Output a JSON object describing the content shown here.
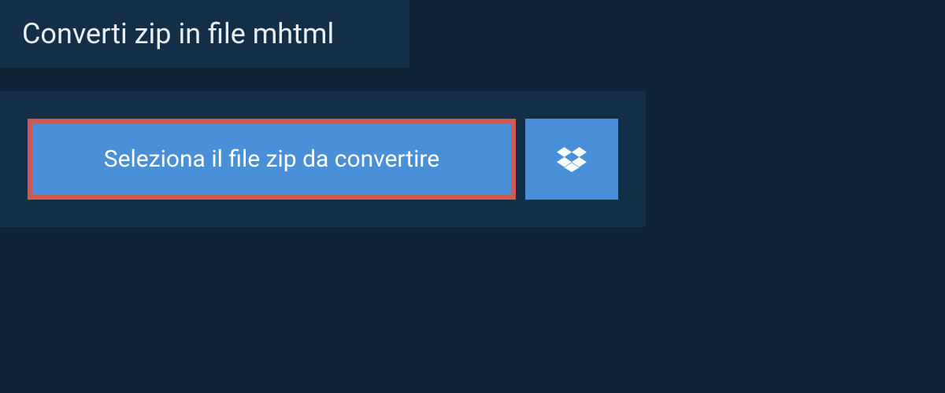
{
  "header": {
    "title": "Converti zip in file mhtml"
  },
  "actions": {
    "select_file_label": "Seleziona il file zip da convertire"
  }
}
